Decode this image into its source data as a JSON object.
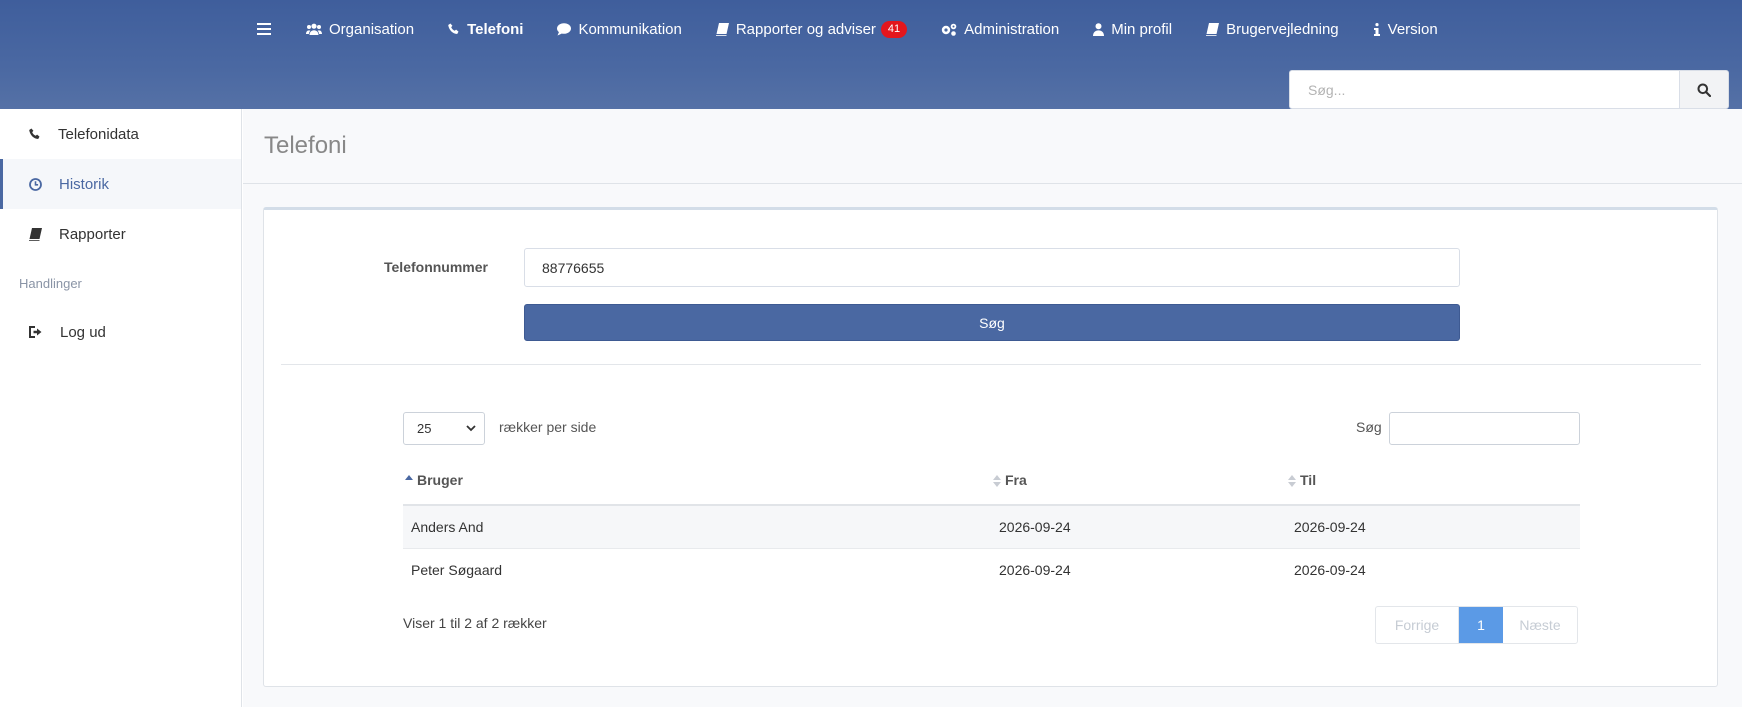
{
  "nav": {
    "items": [
      {
        "label": "Organisation"
      },
      {
        "label": "Telefoni"
      },
      {
        "label": "Kommunikation"
      },
      {
        "label": "Rapporter og adviser",
        "badge": "41"
      },
      {
        "label": "Administration"
      },
      {
        "label": "Min profil"
      },
      {
        "label": "Brugervejledning"
      },
      {
        "label": "Version"
      }
    ]
  },
  "top_search": {
    "placeholder": "Søg..."
  },
  "sidebar": {
    "items": [
      {
        "label": "Telefonidata"
      },
      {
        "label": "Historik"
      },
      {
        "label": "Rapporter"
      }
    ],
    "heading": "Handlinger",
    "logout": "Log ud"
  },
  "page": {
    "title": "Telefoni"
  },
  "form": {
    "phone_label": "Telefonnummer",
    "phone_value": "88776655",
    "search_button": "Søg"
  },
  "table": {
    "page_length": "25",
    "page_length_suffix": "rækker per side",
    "filter_label": "Søg",
    "columns": [
      "Bruger",
      "Fra",
      "Til"
    ],
    "rows": [
      {
        "bruger": "Anders And",
        "fra": "2026-09-24",
        "til": "2026-09-24"
      },
      {
        "bruger": "Peter Søgaard",
        "fra": "2026-09-24",
        "til": "2026-09-24"
      }
    ],
    "info": "Viser 1 til 2 af 2 rækker",
    "pager": {
      "prev": "Forrige",
      "current": "1",
      "next": "Næste"
    }
  },
  "colors": {
    "header": "#4a68a2",
    "primary_button": "#4a68a2",
    "badge": "#e3161d",
    "active_page": "#5b9ae6"
  }
}
